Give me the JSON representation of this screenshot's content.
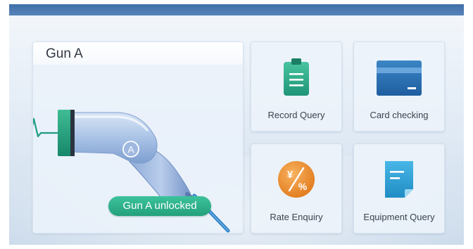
{
  "gun_panel": {
    "title": "Gun A",
    "gun_badge": "A",
    "status": "Gun A unlocked",
    "status_color": "#2bb08a",
    "connector_color": "#1e9c84"
  },
  "tiles": [
    {
      "label": "Record Query",
      "icon": "clipboard-icon",
      "color": "#2ea88a"
    },
    {
      "label": "Card checking",
      "icon": "card-icon",
      "color": "#2f6fad"
    },
    {
      "label": "Rate Enquiry",
      "icon": "rate-coin-icon",
      "color": "#ee8b2c",
      "glyph_top": "¥",
      "glyph_bottom": "%"
    },
    {
      "label": "Equipment Query",
      "icon": "document-icon",
      "color": "#2c9fd2"
    }
  ],
  "colors": {
    "topbar": "#4a78b0",
    "accent_green": "#2bb08a"
  }
}
